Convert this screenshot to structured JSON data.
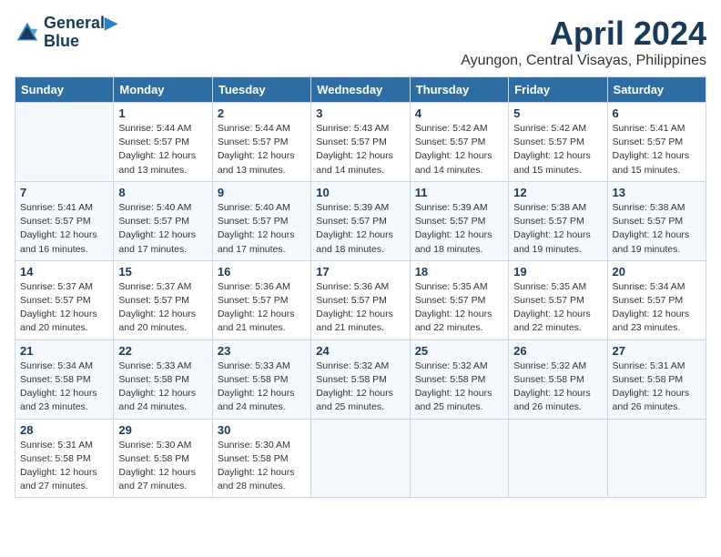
{
  "logo": {
    "line1": "General",
    "line2": "Blue"
  },
  "title": "April 2024",
  "subtitle": "Ayungon, Central Visayas, Philippines",
  "header": {
    "days": [
      "Sunday",
      "Monday",
      "Tuesday",
      "Wednesday",
      "Thursday",
      "Friday",
      "Saturday"
    ]
  },
  "weeks": [
    [
      {
        "day": "",
        "detail": ""
      },
      {
        "day": "1",
        "detail": "Sunrise: 5:44 AM\nSunset: 5:57 PM\nDaylight: 12 hours\nand 13 minutes."
      },
      {
        "day": "2",
        "detail": "Sunrise: 5:44 AM\nSunset: 5:57 PM\nDaylight: 12 hours\nand 13 minutes."
      },
      {
        "day": "3",
        "detail": "Sunrise: 5:43 AM\nSunset: 5:57 PM\nDaylight: 12 hours\nand 14 minutes."
      },
      {
        "day": "4",
        "detail": "Sunrise: 5:42 AM\nSunset: 5:57 PM\nDaylight: 12 hours\nand 14 minutes."
      },
      {
        "day": "5",
        "detail": "Sunrise: 5:42 AM\nSunset: 5:57 PM\nDaylight: 12 hours\nand 15 minutes."
      },
      {
        "day": "6",
        "detail": "Sunrise: 5:41 AM\nSunset: 5:57 PM\nDaylight: 12 hours\nand 15 minutes."
      }
    ],
    [
      {
        "day": "7",
        "detail": "Sunrise: 5:41 AM\nSunset: 5:57 PM\nDaylight: 12 hours\nand 16 minutes."
      },
      {
        "day": "8",
        "detail": "Sunrise: 5:40 AM\nSunset: 5:57 PM\nDaylight: 12 hours\nand 17 minutes."
      },
      {
        "day": "9",
        "detail": "Sunrise: 5:40 AM\nSunset: 5:57 PM\nDaylight: 12 hours\nand 17 minutes."
      },
      {
        "day": "10",
        "detail": "Sunrise: 5:39 AM\nSunset: 5:57 PM\nDaylight: 12 hours\nand 18 minutes."
      },
      {
        "day": "11",
        "detail": "Sunrise: 5:39 AM\nSunset: 5:57 PM\nDaylight: 12 hours\nand 18 minutes."
      },
      {
        "day": "12",
        "detail": "Sunrise: 5:38 AM\nSunset: 5:57 PM\nDaylight: 12 hours\nand 19 minutes."
      },
      {
        "day": "13",
        "detail": "Sunrise: 5:38 AM\nSunset: 5:57 PM\nDaylight: 12 hours\nand 19 minutes."
      }
    ],
    [
      {
        "day": "14",
        "detail": "Sunrise: 5:37 AM\nSunset: 5:57 PM\nDaylight: 12 hours\nand 20 minutes."
      },
      {
        "day": "15",
        "detail": "Sunrise: 5:37 AM\nSunset: 5:57 PM\nDaylight: 12 hours\nand 20 minutes."
      },
      {
        "day": "16",
        "detail": "Sunrise: 5:36 AM\nSunset: 5:57 PM\nDaylight: 12 hours\nand 21 minutes."
      },
      {
        "day": "17",
        "detail": "Sunrise: 5:36 AM\nSunset: 5:57 PM\nDaylight: 12 hours\nand 21 minutes."
      },
      {
        "day": "18",
        "detail": "Sunrise: 5:35 AM\nSunset: 5:57 PM\nDaylight: 12 hours\nand 22 minutes."
      },
      {
        "day": "19",
        "detail": "Sunrise: 5:35 AM\nSunset: 5:57 PM\nDaylight: 12 hours\nand 22 minutes."
      },
      {
        "day": "20",
        "detail": "Sunrise: 5:34 AM\nSunset: 5:57 PM\nDaylight: 12 hours\nand 23 minutes."
      }
    ],
    [
      {
        "day": "21",
        "detail": "Sunrise: 5:34 AM\nSunset: 5:58 PM\nDaylight: 12 hours\nand 23 minutes."
      },
      {
        "day": "22",
        "detail": "Sunrise: 5:33 AM\nSunset: 5:58 PM\nDaylight: 12 hours\nand 24 minutes."
      },
      {
        "day": "23",
        "detail": "Sunrise: 5:33 AM\nSunset: 5:58 PM\nDaylight: 12 hours\nand 24 minutes."
      },
      {
        "day": "24",
        "detail": "Sunrise: 5:32 AM\nSunset: 5:58 PM\nDaylight: 12 hours\nand 25 minutes."
      },
      {
        "day": "25",
        "detail": "Sunrise: 5:32 AM\nSunset: 5:58 PM\nDaylight: 12 hours\nand 25 minutes."
      },
      {
        "day": "26",
        "detail": "Sunrise: 5:32 AM\nSunset: 5:58 PM\nDaylight: 12 hours\nand 26 minutes."
      },
      {
        "day": "27",
        "detail": "Sunrise: 5:31 AM\nSunset: 5:58 PM\nDaylight: 12 hours\nand 26 minutes."
      }
    ],
    [
      {
        "day": "28",
        "detail": "Sunrise: 5:31 AM\nSunset: 5:58 PM\nDaylight: 12 hours\nand 27 minutes."
      },
      {
        "day": "29",
        "detail": "Sunrise: 5:30 AM\nSunset: 5:58 PM\nDaylight: 12 hours\nand 27 minutes."
      },
      {
        "day": "30",
        "detail": "Sunrise: 5:30 AM\nSunset: 5:58 PM\nDaylight: 12 hours\nand 28 minutes."
      },
      {
        "day": "",
        "detail": ""
      },
      {
        "day": "",
        "detail": ""
      },
      {
        "day": "",
        "detail": ""
      },
      {
        "day": "",
        "detail": ""
      }
    ]
  ]
}
